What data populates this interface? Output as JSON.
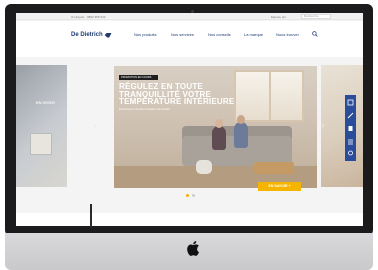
{
  "topbar": {
    "left_text": "Un Expert · 0892 356 543",
    "right_text": "Espace pro",
    "search_placeholder": "Recherche"
  },
  "brand": {
    "logo_text": "De Dietrich"
  },
  "nav": {
    "items": [
      "Nos produits",
      "Nos services",
      "Nos conseils",
      "La marque",
      "Nous trouver"
    ]
  },
  "hero": {
    "badge": "PROMOTION EN COURS",
    "headline": "RÉGULEZ EN TOUTE TRANQUILLITÉ VOTRE TEMPÉRATURE INTÉRIEURE",
    "subline": "Découvrez nos thermostats connectés",
    "cta_label": "EN SAVOIR +",
    "left_panel_text": "EN HIVER"
  },
  "carousel": {
    "slides": 2,
    "active_slide": 1
  },
  "icons": {
    "prev": "chevron-left-icon",
    "next": "chevron-right-icon",
    "search": "search-icon",
    "apple": "apple-logo-icon"
  },
  "colors": {
    "brand_blue": "#1f3c73",
    "accent_yellow": "#f4b400",
    "toolbar_blue": "#2b4c9b"
  }
}
